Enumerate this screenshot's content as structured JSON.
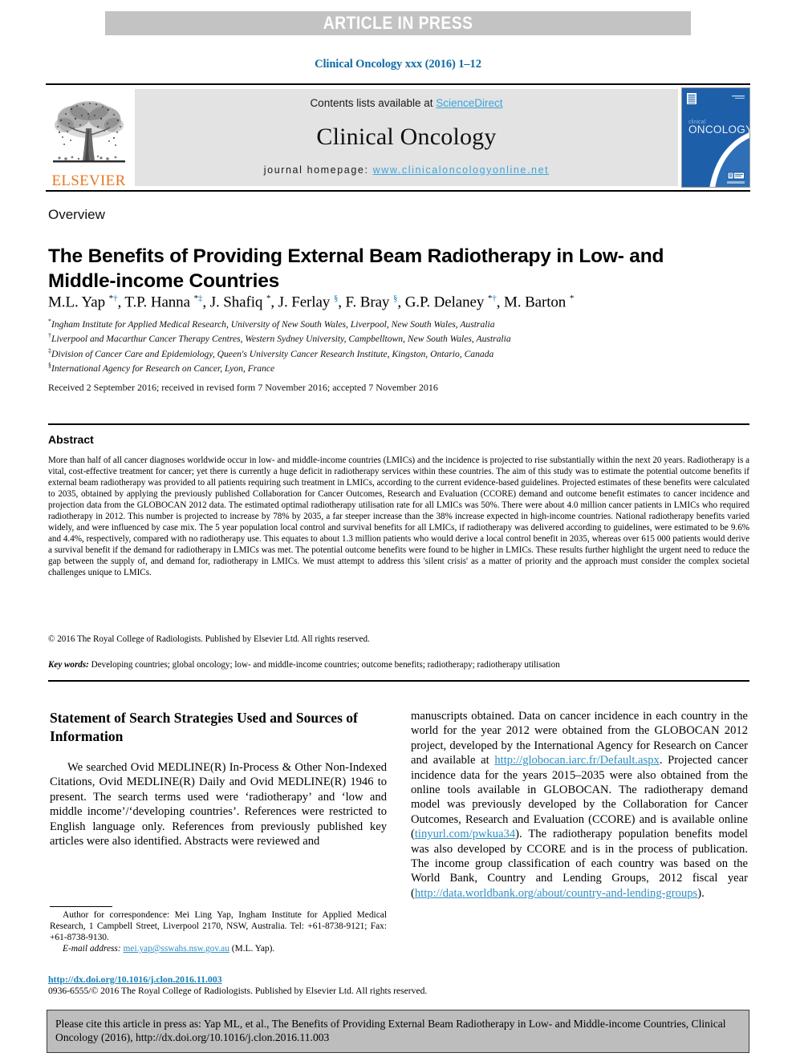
{
  "banner": {
    "text": "ARTICLE IN PRESS"
  },
  "journal_citation": "Clinical Oncology xxx (2016) 1–12",
  "masthead": {
    "contents_prefix": "Contents lists available at ",
    "sciencedirect": "ScienceDirect",
    "journal_title": "Clinical Oncology",
    "homepage_prefix": "journal homepage: ",
    "homepage_url": "www.clinicaloncologyonline.net",
    "publisher_word": "ELSEVIER",
    "publisher_logo_icon": "elsevier-tree-icon",
    "cover_title_small": "clinical",
    "cover_title_large": "ONCOLOGY",
    "accent_blue": "#0f6ba4",
    "link_blue": "#3ba4dd",
    "elsevier_orange": "#e87722",
    "banner_gray": "#c3c3c3",
    "masthead_gray": "#e3e3e3"
  },
  "article": {
    "type_label": "Overview",
    "title": "The Benefits of Providing External Beam Radiotherapy in Low- and Middle-income Countries",
    "authors_html": "M.L. Yap <sup class=\"sym-black\">*</sup><sup class=\"sym-blue\">†</sup>, T.P. Hanna <sup class=\"sym-black\">*</sup><sup class=\"sym-blue\">‡</sup>, J. Shafiq <sup class=\"sym-black\">*</sup>, J. Ferlay <sup class=\"sym-blue\">§</sup>, F. Bray <sup class=\"sym-blue\">§</sup>, G.P. Delaney <sup class=\"sym-black\">*</sup><sup class=\"sym-blue\">†</sup>, M. Barton <sup class=\"sym-black\">*</sup>",
    "affiliations": [
      {
        "symbol": "*",
        "text": "Ingham Institute for Applied Medical Research, University of New South Wales, Liverpool, New South Wales, Australia"
      },
      {
        "symbol": "†",
        "text": "Liverpool and Macarthur Cancer Therapy Centres, Western Sydney University, Campbelltown, New South Wales, Australia"
      },
      {
        "symbol": "‡",
        "text": "Division of Cancer Care and Epidemiology, Queen's University Cancer Research Institute, Kingston, Ontario, Canada"
      },
      {
        "symbol": "§",
        "text": "International Agency for Research on Cancer, Lyon, France"
      }
    ],
    "received": "Received 2 September 2016; received in revised form 7 November 2016; accepted 7 November 2016"
  },
  "abstract": {
    "heading": "Abstract",
    "body": "More than half of all cancer diagnoses worldwide occur in low- and middle-income countries (LMICs) and the incidence is projected to rise substantially within the next 20 years. Radiotherapy is a vital, cost-effective treatment for cancer; yet there is currently a huge deficit in radiotherapy services within these countries. The aim of this study was to estimate the potential outcome benefits if external beam radiotherapy was provided to all patients requiring such treatment in LMICs, according to the current evidence-based guidelines. Projected estimates of these benefits were calculated to 2035, obtained by applying the previously published Collaboration for Cancer Outcomes, Research and Evaluation (CCORE) demand and outcome benefit estimates to cancer incidence and projection data from the GLOBOCAN 2012 data. The estimated optimal radiotherapy utilisation rate for all LMICs was 50%. There were about 4.0 million cancer patients in LMICs who required radiotherapy in 2012. This number is projected to increase by 78% by 2035, a far steeper increase than the 38% increase expected in high-income countries. National radiotherapy benefits varied widely, and were influenced by case mix. The 5 year population local control and survival benefits for all LMICs, if radiotherapy was delivered according to guidelines, were estimated to be 9.6% and 4.4%, respectively, compared with no radiotherapy use. This equates to about 1.3 million patients who would derive a local control benefit in 2035, whereas over 615 000 patients would derive a survival benefit if the demand for radiotherapy in LMICs was met. The potential outcome benefits were found to be higher in LMICs. These results further highlight the urgent need to reduce the gap between the supply of, and demand for, radiotherapy in LMICs. We must attempt to address this 'silent crisis' as a matter of priority and the approach must consider the complex societal challenges unique to LMICs.",
    "copyright": "© 2016 The Royal College of Radiologists. Published by Elsevier Ltd. All rights reserved.",
    "keywords_label": "Key words:",
    "keywords_value": " Developing countries; global oncology; low- and middle-income countries; outcome benefits; radiotherapy; radiotherapy utilisation"
  },
  "body": {
    "left_heading": "Statement of Search Strategies Used and Sources of Information",
    "left_paragraph": "We searched Ovid MEDLINE(R) In-Process & Other Non-Indexed Citations, Ovid MEDLINE(R) Daily and Ovid MEDLINE(R) 1946 to present. The search terms used were ‘radiotherapy’ and ‘low and middle income’/‘developing countries’. References were restricted to English language only. References from previously published key articles were also identified. Abstracts were reviewed and",
    "right_paragraph_part1": "manuscripts obtained. Data on cancer incidence in each country in the world for the year 2012 were obtained from the GLOBOCAN 2012 project, developed by the International Agency for Research on Cancer and available at ",
    "right_link1": "http://globocan.iarc.fr/Default.aspx",
    "right_paragraph_part2": ". Projected cancer incidence data for the years 2015–2035 were also obtained from the online tools available in GLOBOCAN. The radiotherapy demand model was previously developed by the Collaboration for Cancer Outcomes, Research and Evaluation (CCORE) and is available online (",
    "right_link2": "tinyurl.com/pwkua34",
    "right_paragraph_part3": "). The radiotherapy population benefits model was also developed by CCORE and is in the process of publication. The income group classification of each country was based on the World Bank, Country and Lending Groups, 2012 fiscal year (",
    "right_link3": "http://data.worldbank.org/about/country-and-lending-groups",
    "right_paragraph_part4": ")."
  },
  "footnote": {
    "correspondence": "Author for correspondence: Mei Ling Yap, Ingham Institute for Applied Medical Research, 1 Campbell Street, Liverpool 2170, NSW, Australia. Tel: +61-8738-9121; Fax: +61-8738-9130.",
    "email_label": "E-mail address:",
    "email_value": "mei.yap@sswahs.nsw.gov.au",
    "email_suffix": " (M.L. Yap).",
    "doi": "http://dx.doi.org/10.1016/j.clon.2016.11.003",
    "issn_copyright": "0936-6555/© 2016 The Royal College of Radiologists. Published by Elsevier Ltd. All rights reserved."
  },
  "cite_box": {
    "text": "Please cite this article in press as: Yap ML, et al., The Benefits of Providing External Beam Radiotherapy in Low- and Middle-income Countries, Clinical Oncology (2016), http://dx.doi.org/10.1016/j.clon.2016.11.003"
  }
}
